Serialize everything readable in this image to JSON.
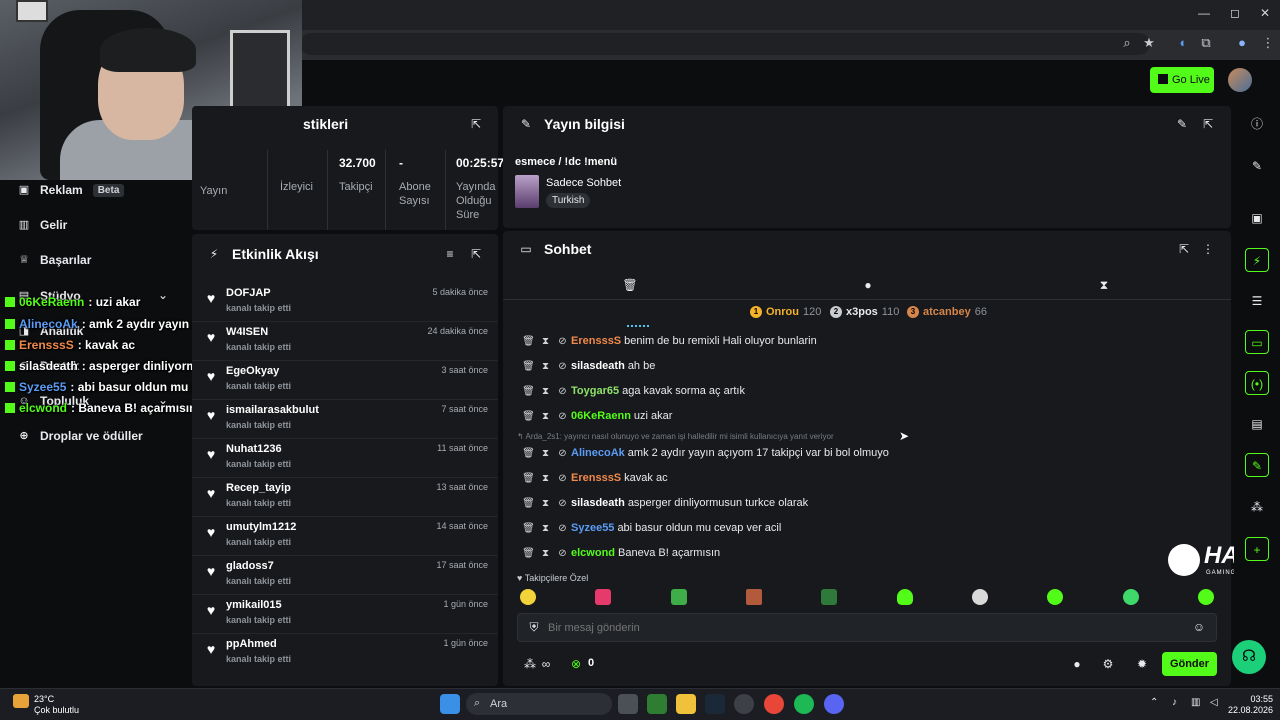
{
  "browser": {
    "window_controls": [
      "—",
      "◻",
      "✕"
    ]
  },
  "header": {
    "go_live_label": "Go Live"
  },
  "sidebar": {
    "items": [
      {
        "label": "Reklam",
        "badge": "Beta",
        "icon": "megaphone-icon"
      },
      {
        "label": "Gelir",
        "icon": "chart-icon"
      },
      {
        "label": "Başarılar",
        "icon": "trophy-icon"
      },
      {
        "label": "Stüdyo",
        "icon": "studio-icon"
      },
      {
        "label": "Analitik",
        "icon": "analytics-icon"
      },
      {
        "label": "Destek",
        "icon": "support-icon"
      },
      {
        "label": "Topluluk",
        "icon": "community-icon"
      },
      {
        "label": "Droplar ve ödüller",
        "icon": "gift-icon"
      }
    ]
  },
  "overlay_chat": [
    {
      "user": "06KeRaenn",
      "text": ": uzi akar",
      "color": "#53fc18"
    },
    {
      "user": "AlinecoAk",
      "text": ": amk 2 aydır yayın açıyom 17 takipçi var bi bol",
      "color": "#5b9cf5"
    },
    {
      "user": "ErensssS",
      "text": ": kavak ac",
      "color": "#f08a4b"
    },
    {
      "user": "silasdeath",
      "text": ": asperger dinliyormusun turkce olarak",
      "color": "#ffffff"
    },
    {
      "user": "Syzee55",
      "text": ": abi basur oldun mu cevap ver acil",
      "color": "#5b9cf5"
    },
    {
      "user": "elcwond",
      "text": ": Baneva B! açarmısın",
      "color": "#53fc18"
    }
  ],
  "stats_panel": {
    "title_fragment": "stikleri",
    "columns": [
      {
        "value": "",
        "label": "Yayın"
      },
      {
        "value": "",
        "label": "İzleyici"
      },
      {
        "value": "32.700",
        "label": "Takipçi"
      },
      {
        "value": "-",
        "label": "Abone Sayısı"
      },
      {
        "value": "00:25:57",
        "label": "Yayında Olduğu Süre"
      }
    ]
  },
  "activity_feed": {
    "title": "Etkinlik Akışı",
    "events": [
      {
        "name": "DOFJAP",
        "sub": "kanalı takip etti",
        "time": "5 dakika önce"
      },
      {
        "name": "W4ISEN",
        "sub": "kanalı takip etti",
        "time": "24 dakika önce"
      },
      {
        "name": "EgeOkyay",
        "sub": "kanalı takip etti",
        "time": "3 saat önce"
      },
      {
        "name": "ismailarasakbulut",
        "sub": "kanalı takip etti",
        "time": "7 saat önce"
      },
      {
        "name": "Nuhat1236",
        "sub": "kanalı takip etti",
        "time": "11 saat önce"
      },
      {
        "name": "Recep_tayip",
        "sub": "kanalı takip etti",
        "time": "13 saat önce"
      },
      {
        "name": "umutylm1212",
        "sub": "kanalı takip etti",
        "time": "14 saat önce"
      },
      {
        "name": "gladoss7",
        "sub": "kanalı takip etti",
        "time": "17 saat önce"
      },
      {
        "name": "ymikail015",
        "sub": "kanalı takip etti",
        "time": "1 gün önce"
      },
      {
        "name": "ppAhmed",
        "sub": "kanalı takip etti",
        "time": "1 gün önce"
      }
    ]
  },
  "stream_info": {
    "title": "Yayın bilgisi",
    "stream_title": "esmece / !dc !menü",
    "category": "Sadece Sohbet",
    "language": "Turkish"
  },
  "chat": {
    "title": "Sohbet",
    "leaderboard": [
      {
        "rank": "1",
        "user": "Onrou",
        "count": "120",
        "color": "#f5b32a"
      },
      {
        "rank": "2",
        "user": "x3pos",
        "count": "110",
        "color": "#c9ccd0"
      },
      {
        "rank": "3",
        "user": "atcanbey",
        "count": "66",
        "color": "#d6864a"
      }
    ],
    "messages": [
      {
        "user": "ErensssS",
        "text": "benim de bu remixli Hali oluyor bunlarin",
        "color": "#f08a4b"
      },
      {
        "user": "silasdeath",
        "text": "ah be",
        "color": "#ffffff"
      },
      {
        "user": "Toygar65",
        "text": "aga kavak sorma aç artık",
        "color": "#8fe36a"
      },
      {
        "user": "06KeRaenn",
        "text": "uzi akar",
        "color": "#53fc18"
      },
      {
        "user": "AlinecoAk",
        "text": "amk 2 aydır yayın açıyom 17 takipçi var bi bol olmuyo",
        "color": "#5b9cf5"
      },
      {
        "user": "ErensssS",
        "text": "kavak ac",
        "color": "#f08a4b"
      },
      {
        "user": "silasdeath",
        "text": "asperger dinliyormusun turkce olarak",
        "color": "#ffffff"
      },
      {
        "user": "Syzee55",
        "text": "abi basur oldun mu cevap ver acil",
        "color": "#5b9cf5"
      },
      {
        "user": "elcwond",
        "text": "Baneva B! açarmısın",
        "color": "#53fc18"
      }
    ],
    "reply_hint": "Arda_2s1: yayıncı nasıl olunuyo ve zaman işi halledilir mi isimli kullanıcıya yanıt veriyor",
    "emote_section_label": "Takipçilere Özel",
    "input_placeholder": "Bir mesaj gönderin",
    "points_value": "0",
    "send_label": "Gönder"
  },
  "watermark": {
    "brand": "HAWK",
    "tagline": "GAMING CHAIR"
  },
  "taskbar": {
    "weather_temp": "23°C",
    "weather_desc": "Çok bulutlu",
    "search_placeholder": "Ara",
    "time": "03:55",
    "date": "22.08.2026"
  }
}
